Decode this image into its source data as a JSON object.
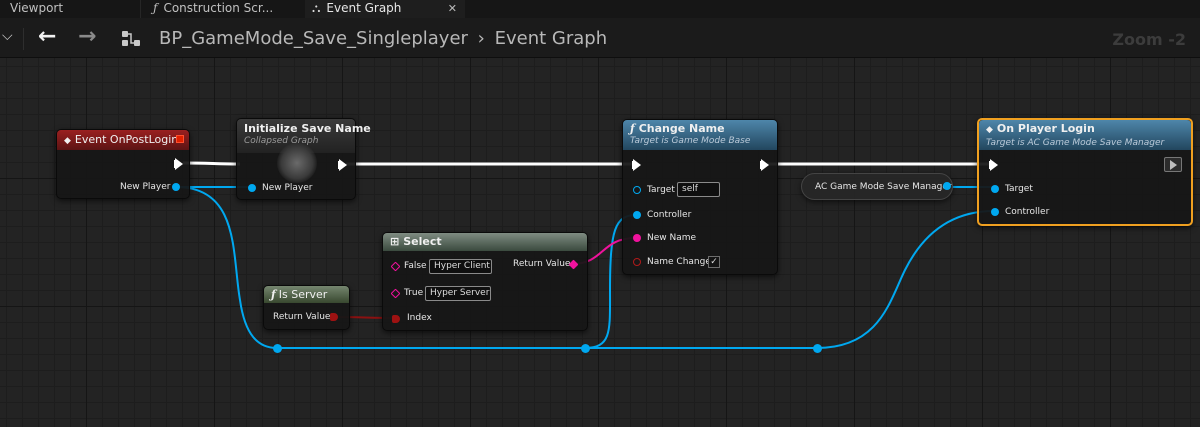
{
  "tabs": [
    {
      "label": "Viewport"
    },
    {
      "label": "Construction Scr..."
    },
    {
      "label": "Event Graph"
    }
  ],
  "tab_icons": {
    "function": "ƒ",
    "graph": "⛬",
    "close": "✕"
  },
  "toolbar": {
    "caret": "⌵",
    "back": "←",
    "forward": "→",
    "blueprint_name": "BP_GameMode_Save_Singleplayer",
    "separator": "›",
    "graph_name": "Event Graph",
    "zoom": "Zoom -2"
  },
  "nodes": {
    "event_postlogin": {
      "icon": "◆",
      "title": "Event OnPostLogin",
      "pins": {
        "new_player": "New Player"
      }
    },
    "init_save_name": {
      "title": "Initialize Save Name",
      "subtitle": "Collapsed Graph",
      "pins": {
        "new_player": "New Player"
      }
    },
    "change_name": {
      "icon": "ƒ",
      "title": "Change Name",
      "subtitle": "Target is Game Mode Base",
      "pins": {
        "target": "Target",
        "target_value": "self",
        "controller": "Controller",
        "new_name": "New Name",
        "name_change": "Name Change",
        "name_change_checked": "✓"
      }
    },
    "on_player_login": {
      "icon": "◆",
      "title": "On Player Login",
      "subtitle": "Target is AC Game Mode Save Manager",
      "pins": {
        "target": "Target",
        "controller": "Controller"
      }
    },
    "save_manager_var": {
      "label": "AC Game Mode Save Manager"
    },
    "select": {
      "icon": "⊞",
      "title": "Select",
      "pins": {
        "false": "False",
        "false_value": "Hyper Client",
        "true": "True",
        "true_value": "Hyper Server",
        "index": "Index",
        "return_value": "Return Value"
      }
    },
    "is_server": {
      "icon": "ƒ",
      "title": "Is Server",
      "pins": {
        "return_value": "Return Value"
      }
    }
  },
  "colors": {
    "exec_wire": "#ffffff",
    "object_wire": "#00a8f0",
    "string_wire": "#f0129d",
    "bool_wire": "#8c1111",
    "event_header": "#8b1a1a",
    "function_header": "#3e6e8c",
    "pure_header": "#4e5c48",
    "selection": "#f0a020"
  }
}
